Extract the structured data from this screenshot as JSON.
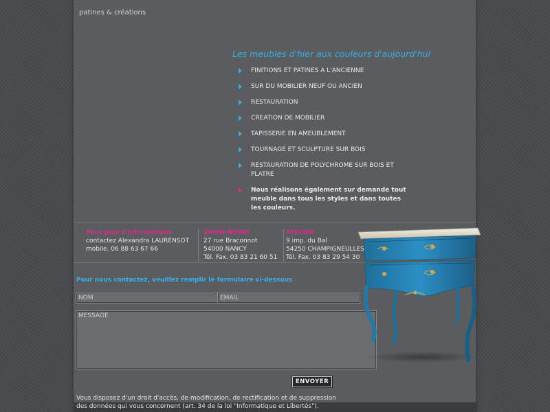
{
  "brand": "patines & créations",
  "tagline": "Les meubles d'hier aux couleurs d'aujourd'hui",
  "services": [
    "FINITIONS ET PATINES A L'ANCIENNE",
    "SUR DU MOBILIER NEUF OU ANCIEN",
    "RESTAURATION",
    "CREATION DE MOBILIER",
    "TAPISSERIE EN AMEUBLEMENT",
    "TOURNAGE ET SCULPTURE SUR BOIS",
    "RESTAURATION DE POLYCHROME SUR BOIS ET PLATRE"
  ],
  "special_service": "Nous réalisons également sur demande tout meuble dans tous les styles et dans toutes les couleurs.",
  "contact": {
    "info": {
      "title": "Pour plus d'informations",
      "line1": "contactez Alexandra LAURENSOT",
      "line2": "mobile. 06 88 63 67 66"
    },
    "showroom": {
      "title": "SHOW-ROOM",
      "line1": "27 rue Braconnot",
      "line2": "54000 NANCY",
      "line3": "Tél. Fax. 03 83 21 60 51"
    },
    "atelier": {
      "title": "ATELIER",
      "line1": "9 imp. du Bal",
      "line2": "54250 CHAMPIGNEULLES",
      "line3": "Tél. Fax. 03 83 29 54 30"
    }
  },
  "form": {
    "title": "Pour nous contactez, veuillez remplir le formulaire ci-dessous",
    "nom_placeholder": "NOM",
    "email_placeholder": "EMAIL",
    "message_placeholder": "MESSAGE",
    "submit_label": "ENVOYER"
  },
  "legal": "Vous disposez d'un droit d'accès, de modification, de rectification et de suppression des données qui vous concernent (art. 34 de la loi \"Informatique et Libertés\").",
  "colors": {
    "accent_blue": "#37b0f0",
    "accent_pink": "#e0288c",
    "page_bg": "#5a5c5e",
    "outer_bg": "#4a4b4c"
  }
}
